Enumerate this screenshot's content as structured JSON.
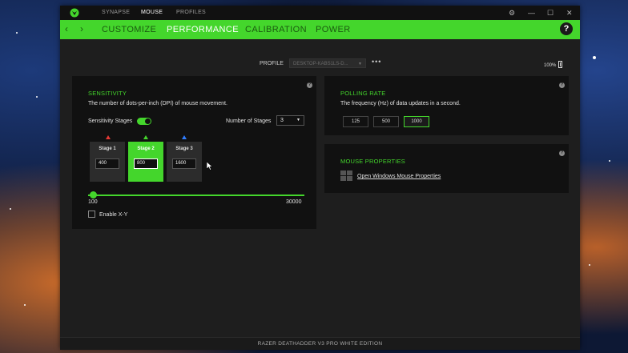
{
  "topnav": {
    "synapse": "SYNAPSE",
    "mouse": "MOUSE",
    "profiles": "PROFILES"
  },
  "window_controls": {
    "settings_glyph": "⚙",
    "minimize_glyph": "—",
    "maximize_glyph": "☐",
    "close_glyph": "✕"
  },
  "tabs": {
    "customize": "CUSTOMIZE",
    "performance": "PERFORMANCE",
    "calibration": "CALIBRATION",
    "power": "POWER"
  },
  "nav": {
    "back_glyph": "‹",
    "forward_glyph": "›",
    "help_glyph": "?"
  },
  "profile": {
    "label": "PROFILE",
    "value": "DESKTOP-KABS1LS-D...",
    "more": "•••"
  },
  "battery": {
    "percent": "100%"
  },
  "sensitivity": {
    "title": "SENSITIVITY",
    "description": "The number of dots-per-inch (DPI) of mouse movement.",
    "stages_label": "Sensitivity Stages",
    "stages_enabled": true,
    "number_of_stages_label": "Number of Stages",
    "number_of_stages_value": "3",
    "stages": [
      {
        "name": "Stage 1",
        "value": "400",
        "indicator_color": "#e53935"
      },
      {
        "name": "Stage 2",
        "value": "800",
        "indicator_color": "#44d62c",
        "active": true
      },
      {
        "name": "Stage 3",
        "value": "1600",
        "indicator_color": "#2f7dff"
      }
    ],
    "slider_min": "100",
    "slider_max": "30000",
    "slider_value": 800,
    "enable_xy_label": "Enable X-Y",
    "enable_xy_checked": false
  },
  "polling_rate": {
    "title": "POLLING RATE",
    "description": "The frequency (Hz) of data updates in a second.",
    "options": [
      "125",
      "500",
      "1000"
    ],
    "selected": "1000"
  },
  "mouse_properties": {
    "title": "MOUSE PROPERTIES",
    "link": "Open Windows Mouse Properties"
  },
  "footer": {
    "device": "RAZER DEATHADDER V3 PRO WHITE EDITION"
  },
  "colors": {
    "accent": "#44d62c",
    "panel_bg": "#111111",
    "window_bg": "#1e1e1e"
  }
}
